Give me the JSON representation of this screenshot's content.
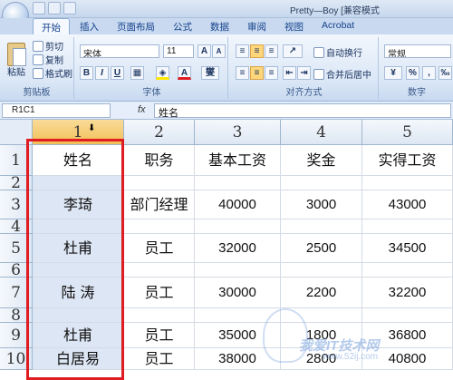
{
  "title_bar": {
    "title": "Pretty—Boy  [兼容模式"
  },
  "tabs": [
    "开始",
    "插入",
    "页面布局",
    "公式",
    "数据",
    "审阅",
    "视图",
    "Acrobat"
  ],
  "ribbon": {
    "clipboard": {
      "paste": "粘贴",
      "cut": "剪切",
      "copy": "复制",
      "format_painter": "格式刷",
      "label": "剪贴板"
    },
    "font": {
      "name": "宋体",
      "size": "11",
      "grow": "A",
      "shrink": "A",
      "bold": "B",
      "italic": "I",
      "underline": "U",
      "font_color": "A",
      "phonetic": "燮",
      "label": "字体"
    },
    "alignment": {
      "wrap": "自动换行",
      "merge": "合并后居中",
      "label": "对齐方式"
    },
    "number": {
      "format": "常规",
      "percent": "%",
      "comma": ",",
      "label": "数字"
    }
  },
  "formula_bar": {
    "name_box": "R1C1",
    "fx": "fx",
    "content": "姓名"
  },
  "columns": [
    "1",
    "2",
    "3",
    "4",
    "5"
  ],
  "rows": [
    "1",
    "2",
    "3",
    "4",
    "5",
    "6",
    "7",
    "8",
    "9",
    "10"
  ],
  "cells": [
    [
      "姓名",
      "职务",
      "基本工资",
      "奖金",
      "实得工资"
    ],
    [
      "",
      "",
      "",
      "",
      ""
    ],
    [
      "李琦",
      "部门经理",
      "40000",
      "3000",
      "43000"
    ],
    [
      "",
      "",
      "",
      "",
      ""
    ],
    [
      "杜甫",
      "员工",
      "32000",
      "2500",
      "34500"
    ],
    [
      "",
      "",
      "",
      "",
      ""
    ],
    [
      "陆  涛",
      "员工",
      "30000",
      "2200",
      "32200"
    ],
    [
      "",
      "",
      "",
      "",
      ""
    ],
    [
      "杜甫",
      "员工",
      "35000",
      "1800",
      "36800"
    ],
    [
      "白居易",
      "员工",
      "38000",
      "2800",
      "40800"
    ]
  ],
  "watermark": {
    "line1": "我爱IT技术网",
    "line2": "www.52ij.com"
  }
}
